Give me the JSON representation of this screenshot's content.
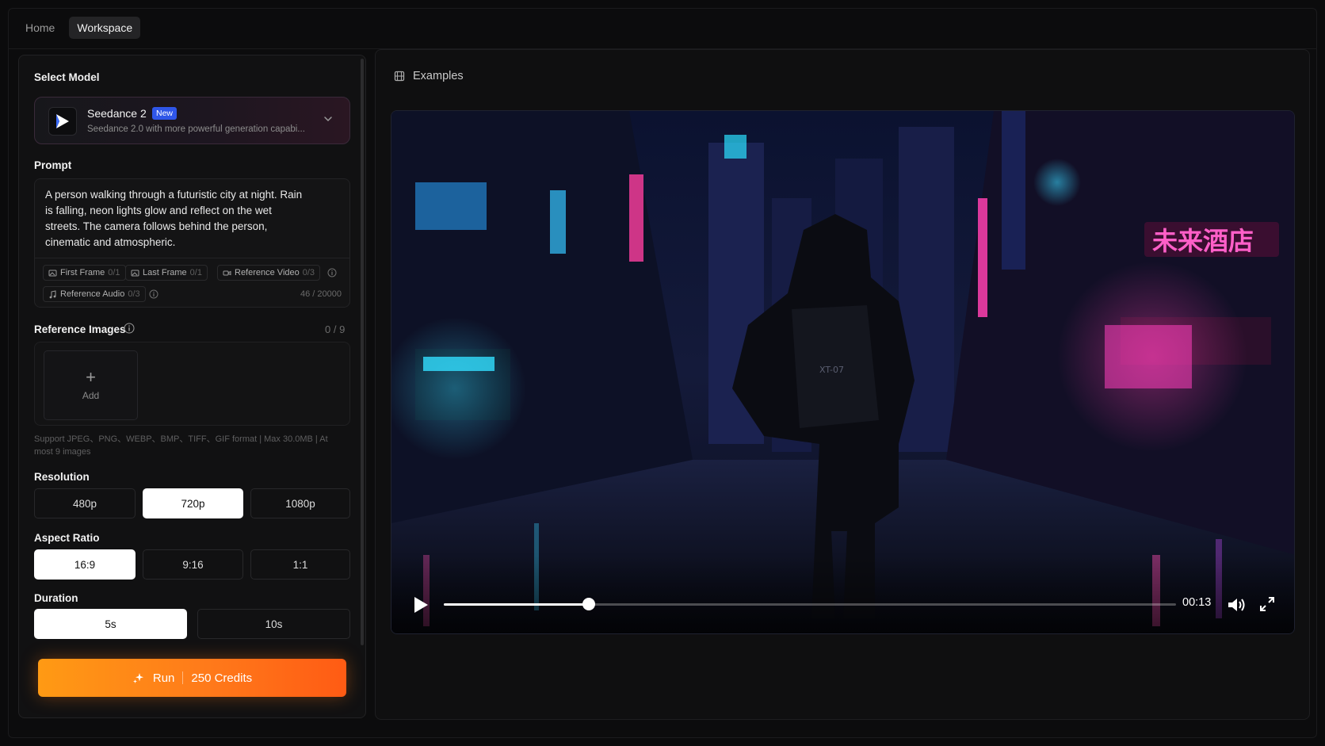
{
  "tabs": [
    {
      "label": "Home",
      "active": false
    },
    {
      "label": "Workspace",
      "active": true
    }
  ],
  "model": {
    "section_label": "Select Model",
    "name": "Seedance 2",
    "badge": "New",
    "description": "Seedance 2.0 with more powerful generation capabi..."
  },
  "prompt": {
    "section_label": "Prompt",
    "text": "A person walking through a futuristic city at night. Rain is falling, neon lights glow and reflect on the wet streets.  The camera follows behind the person, cinematic and atmospheric.",
    "chips": {
      "first_frame": {
        "label": "First Frame",
        "count": "0/1"
      },
      "last_frame": {
        "label": "Last Frame",
        "count": "0/1"
      },
      "reference_video": {
        "label": "Reference Video",
        "count": "0/3"
      },
      "reference_audio": {
        "label": "Reference Audio",
        "count": "0/3"
      }
    },
    "char_count": "46 / 20000"
  },
  "reference_images": {
    "section_label": "Reference Images",
    "count": "0 / 9",
    "add_label": "Add",
    "support_text": "Support JPEG、PNG、WEBP、BMP、TIFF、GIF format | Max 30.0MB | At most 9 images"
  },
  "resolution": {
    "section_label": "Resolution",
    "options": [
      "480p",
      "720p",
      "1080p"
    ],
    "selected": "720p"
  },
  "aspect_ratio": {
    "section_label": "Aspect Ratio",
    "options": [
      "16:9",
      "9:16",
      "1:1"
    ],
    "selected": "16:9"
  },
  "duration": {
    "section_label": "Duration",
    "options": [
      "5s",
      "10s"
    ],
    "selected": "5s"
  },
  "run": {
    "label": "Run",
    "credits": "250 Credits"
  },
  "examples": {
    "label": "Examples"
  },
  "video_player": {
    "time": "00:13",
    "progress": 0.198,
    "scene_sign_text": "未来酒店",
    "backpack_text": "XT-07"
  },
  "colors": {
    "accent_orange": "#ff8a14",
    "new_badge": "#2f56e8",
    "selected_option_bg": "#ffffff"
  }
}
